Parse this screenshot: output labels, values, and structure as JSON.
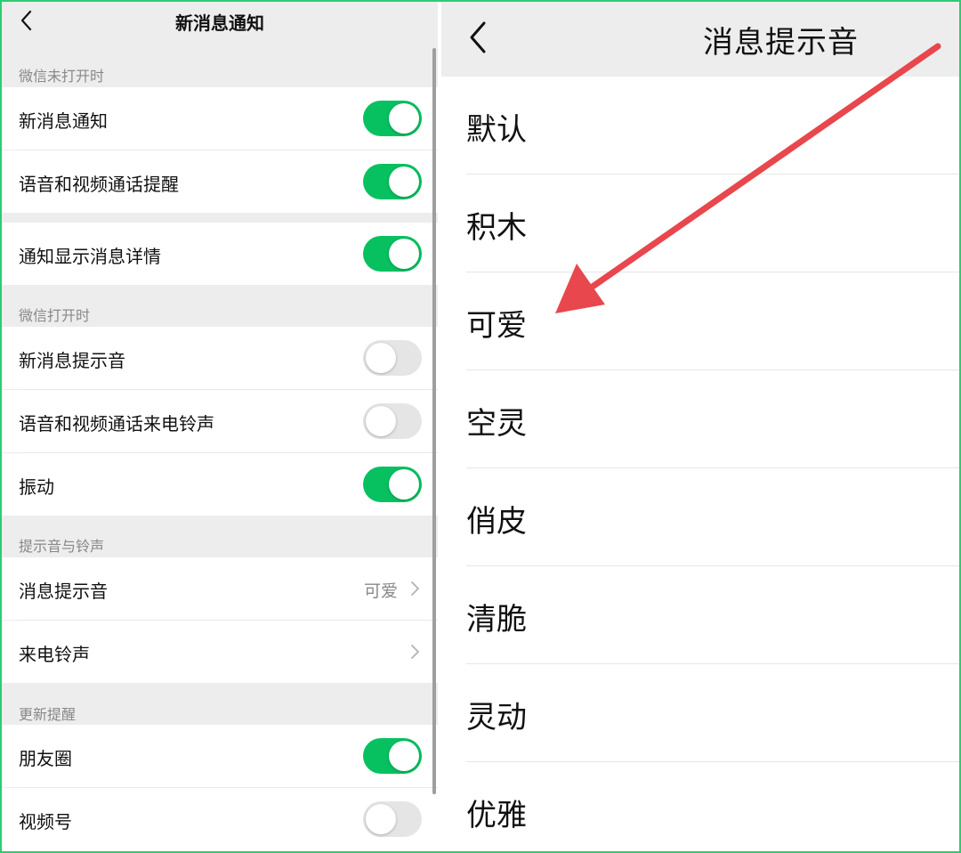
{
  "left": {
    "title": "新消息通知",
    "sections": [
      {
        "label": "微信未打开时"
      },
      {
        "label": "微信打开时"
      },
      {
        "label": "提示音与铃声"
      },
      {
        "label": "更新提醒"
      }
    ],
    "rows": {
      "new_msg": {
        "label": "新消息通知",
        "on": true
      },
      "voice_video_remind": {
        "label": "语音和视频通话提醒",
        "on": true
      },
      "show_detail": {
        "label": "通知显示消息详情",
        "on": true
      },
      "new_msg_sound": {
        "label": "新消息提示音",
        "on": false
      },
      "call_ringtone_open": {
        "label": "语音和视频通话来电铃声",
        "on": false
      },
      "vibrate": {
        "label": "振动",
        "on": true
      },
      "msg_sound": {
        "label": "消息提示音",
        "value": "可爱"
      },
      "ringtone": {
        "label": "来电铃声"
      },
      "moments": {
        "label": "朋友圈",
        "on": true
      },
      "channels": {
        "label": "视频号",
        "on": false
      }
    }
  },
  "right": {
    "title": "消息提示音",
    "sounds": [
      "默认",
      "积木",
      "可爱",
      "空灵",
      "俏皮",
      "清脆",
      "灵动",
      "优雅"
    ]
  },
  "colors": {
    "toggle_on": "#07c160",
    "toggle_off": "#e5e5e5",
    "annotation_arrow": "#e8474d",
    "frame": "#2ecc71"
  },
  "icons": {
    "back": "chevron-left-icon",
    "chevron": "chevron-right-icon",
    "annotation": "red-arrow-annotation"
  }
}
